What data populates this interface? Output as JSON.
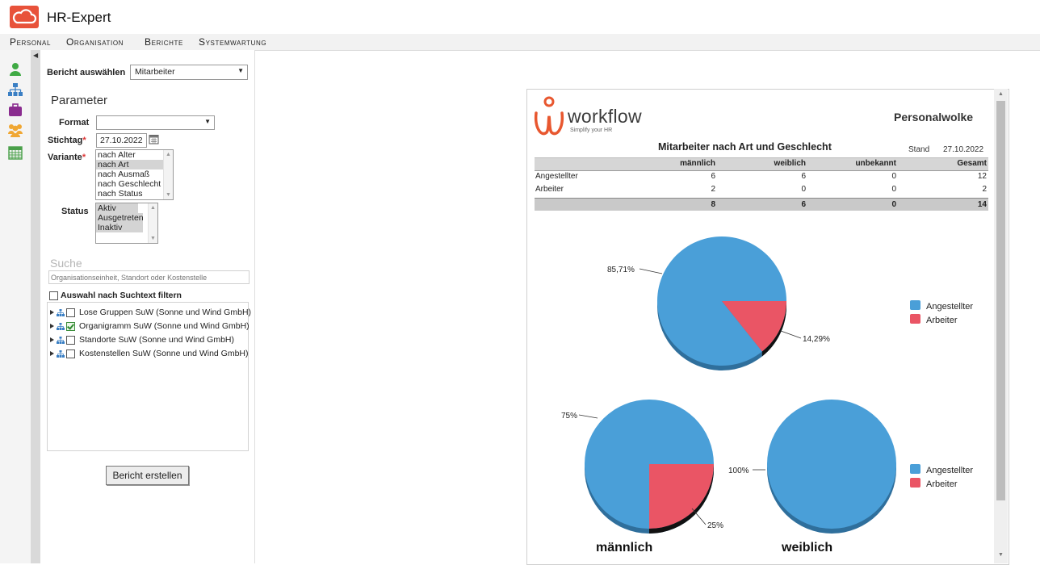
{
  "app": {
    "title": "HR-Expert"
  },
  "menu": [
    "Personal",
    "Organisation",
    "Berichte",
    "Systemwartung"
  ],
  "icons": [
    "person-icon",
    "org-chart-icon",
    "briefcase-icon",
    "group-icon",
    "calendar-icon"
  ],
  "left": {
    "report_label": "Bericht auswählen",
    "report_value": "Mitarbeiter",
    "params_heading": "Parameter",
    "format_label": "Format",
    "format_value": "",
    "date_label": "Stichtag",
    "date_value": "27.10.2022",
    "variant_label": "Variante",
    "variant_options": [
      "nach Alter",
      "nach Art",
      "nach Ausmaß",
      "nach Geschlecht",
      "nach Status"
    ],
    "variant_selected": "nach Art",
    "status_label": "Status",
    "status_options": [
      "Aktiv",
      "Ausgetreten",
      "Inaktiv"
    ],
    "search_heading": "Suche",
    "search_placeholder": "Organisationseinheit, Standort oder Kostenstelle",
    "filter_label": "Auswahl nach Suchtext filtern",
    "tree": [
      {
        "label": "Lose Gruppen SuW (Sonne und Wind GmbH)",
        "checked": false
      },
      {
        "label": "Organigramm SuW (Sonne und Wind GmbH)",
        "checked": true
      },
      {
        "label": "Standorte SuW (Sonne und Wind GmbH)",
        "checked": false
      },
      {
        "label": "Kostenstellen SuW (Sonne und Wind GmbH)",
        "checked": false
      }
    ],
    "create_button": "Bericht erstellen"
  },
  "report": {
    "brand": "workflow",
    "tagline": "Simplify your HR",
    "company": "Personalwolke",
    "title": "Mitarbeiter nach Art und Geschlecht",
    "stand_label": "Stand",
    "stand_date": "27.10.2022",
    "columns": [
      "männlich",
      "weiblich",
      "unbekannt",
      "Gesamt"
    ],
    "rows": [
      {
        "label": "Angestellter",
        "values": [
          "6",
          "6",
          "0",
          "12"
        ]
      },
      {
        "label": "Arbeiter",
        "values": [
          "2",
          "0",
          "0",
          "2"
        ]
      }
    ],
    "totals": [
      "8",
      "6",
      "0",
      "14"
    ],
    "chart_main_labels": [
      "85,71%",
      "14,29%"
    ],
    "chart_m_labels": [
      "75%",
      "25%"
    ],
    "chart_f_label": "100%",
    "chart_m_title": "männlich",
    "chart_f_title": "weiblich",
    "legend": [
      "Angestellter",
      "Arbeiter"
    ],
    "colors": {
      "angestellter": "#4a9fd8",
      "arbeiter": "#ea5565"
    }
  },
  "chart_data": [
    {
      "type": "pie",
      "categories": [
        "Angestellter",
        "Arbeiter"
      ],
      "values": [
        85.71,
        14.29
      ],
      "title": ""
    },
    {
      "type": "pie",
      "categories": [
        "Angestellter",
        "Arbeiter"
      ],
      "values": [
        75,
        25
      ],
      "title": "männlich"
    },
    {
      "type": "pie",
      "categories": [
        "Angestellter",
        "Arbeiter"
      ],
      "values": [
        100,
        0
      ],
      "title": "weiblich"
    }
  ]
}
